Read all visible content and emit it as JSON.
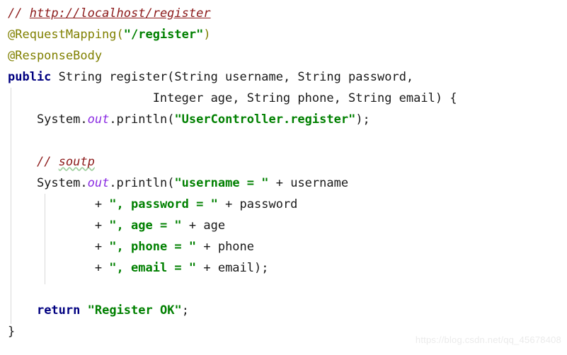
{
  "editor": {
    "language": "Java",
    "background_color": "#ffffff",
    "font_size_px": 17,
    "line_height_px": 30,
    "colors": {
      "keyword": "#000080",
      "string": "#008000",
      "comment": "#8c1a1a",
      "annotation": "#808000",
      "static_field": "#8a2be2",
      "plain_text": "#1a1a1a",
      "indent_guide": "#d8d8d8",
      "typo_squiggle": "#9dcf9d",
      "watermark": "#ebebeb"
    }
  },
  "code": {
    "line1": {
      "comment_marker": "// ",
      "url": "http://localhost/register"
    },
    "line2": {
      "annotation": "@RequestMapping(",
      "string": "\"/register\"",
      "close": ")"
    },
    "line3": {
      "annotation": "@ResponseBody"
    },
    "line4": {
      "keyword": "public",
      "rest": " String register(String username, String password,"
    },
    "line5": {
      "text": "                    Integer age, String phone, String email) {"
    },
    "line6": {
      "indent": "    System.",
      "static_field": "out",
      "mid": ".println(",
      "string": "\"UserController.register\"",
      "tail": ");"
    },
    "line7": {
      "text": ""
    },
    "line8": {
      "indent": "    ",
      "comment_marker": "// ",
      "typo": "soutp"
    },
    "line9": {
      "indent": "    System.",
      "static_field": "out",
      "mid": ".println(",
      "string": "\"username = \"",
      "tail": " + username"
    },
    "line10": {
      "indent": "            + ",
      "string": "\", password = \"",
      "tail": " + password"
    },
    "line11": {
      "indent": "            + ",
      "string": "\", age = \"",
      "tail": " + age"
    },
    "line12": {
      "indent": "            + ",
      "string": "\", phone = \"",
      "tail": " + phone"
    },
    "line13": {
      "indent": "            + ",
      "string": "\", email = \"",
      "tail": " + email);"
    },
    "line14": {
      "text": ""
    },
    "line15": {
      "indent": "    ",
      "keyword": "return",
      "space": " ",
      "string": "\"Register OK\"",
      "tail": ";"
    },
    "line16": {
      "text": "}"
    }
  },
  "watermark": {
    "text": "https://blog.csdn.net/qq_45678408"
  }
}
